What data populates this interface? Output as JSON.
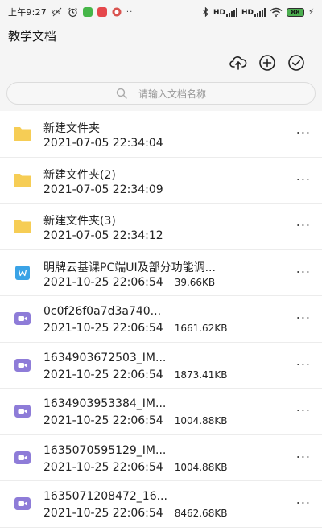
{
  "status_bar": {
    "time": "上午9:27",
    "network_speed": "K/s",
    "signal_a_label": "HD",
    "signal_b_label": "HD",
    "battery": "88",
    "more_dots": "··"
  },
  "header": {
    "title": "教学文档"
  },
  "search": {
    "placeholder": "请输入文档名称"
  },
  "colors": {
    "folder": "#f6cd55",
    "word": "#3aa3e6",
    "video": "#8e7cd8",
    "app_green": "#46b649",
    "app_red": "#e5474b",
    "app_red_badge": "#d9534f"
  },
  "files": [
    {
      "name": "新建文件夹",
      "date": "2021-07-05 22:34:04",
      "size": "",
      "type": "folder"
    },
    {
      "name": "新建文件夹(2)",
      "date": "2021-07-05 22:34:09",
      "size": "",
      "type": "folder"
    },
    {
      "name": "新建文件夹(3)",
      "date": "2021-07-05 22:34:12",
      "size": "",
      "type": "folder"
    },
    {
      "name": "明牌云基课PC端UI及部分功能调...",
      "date": "2021-10-25 22:06:54",
      "size": "39.66KB",
      "type": "word"
    },
    {
      "name": "0c0f26f0a7d3a740...",
      "date": "2021-10-25 22:06:54",
      "size": "1661.62KB",
      "type": "video"
    },
    {
      "name": "1634903672503_IM...",
      "date": "2021-10-25 22:06:54",
      "size": "1873.41KB",
      "type": "video"
    },
    {
      "name": "1634903953384_IM...",
      "date": "2021-10-25 22:06:54",
      "size": "1004.88KB",
      "type": "video"
    },
    {
      "name": "1635070595129_IM...",
      "date": "2021-10-25 22:06:54",
      "size": "1004.88KB",
      "type": "video"
    },
    {
      "name": "1635071208472_16...",
      "date": "2021-10-25 22:06:54",
      "size": "8462.68KB",
      "type": "video"
    }
  ],
  "row_more_label": "···"
}
